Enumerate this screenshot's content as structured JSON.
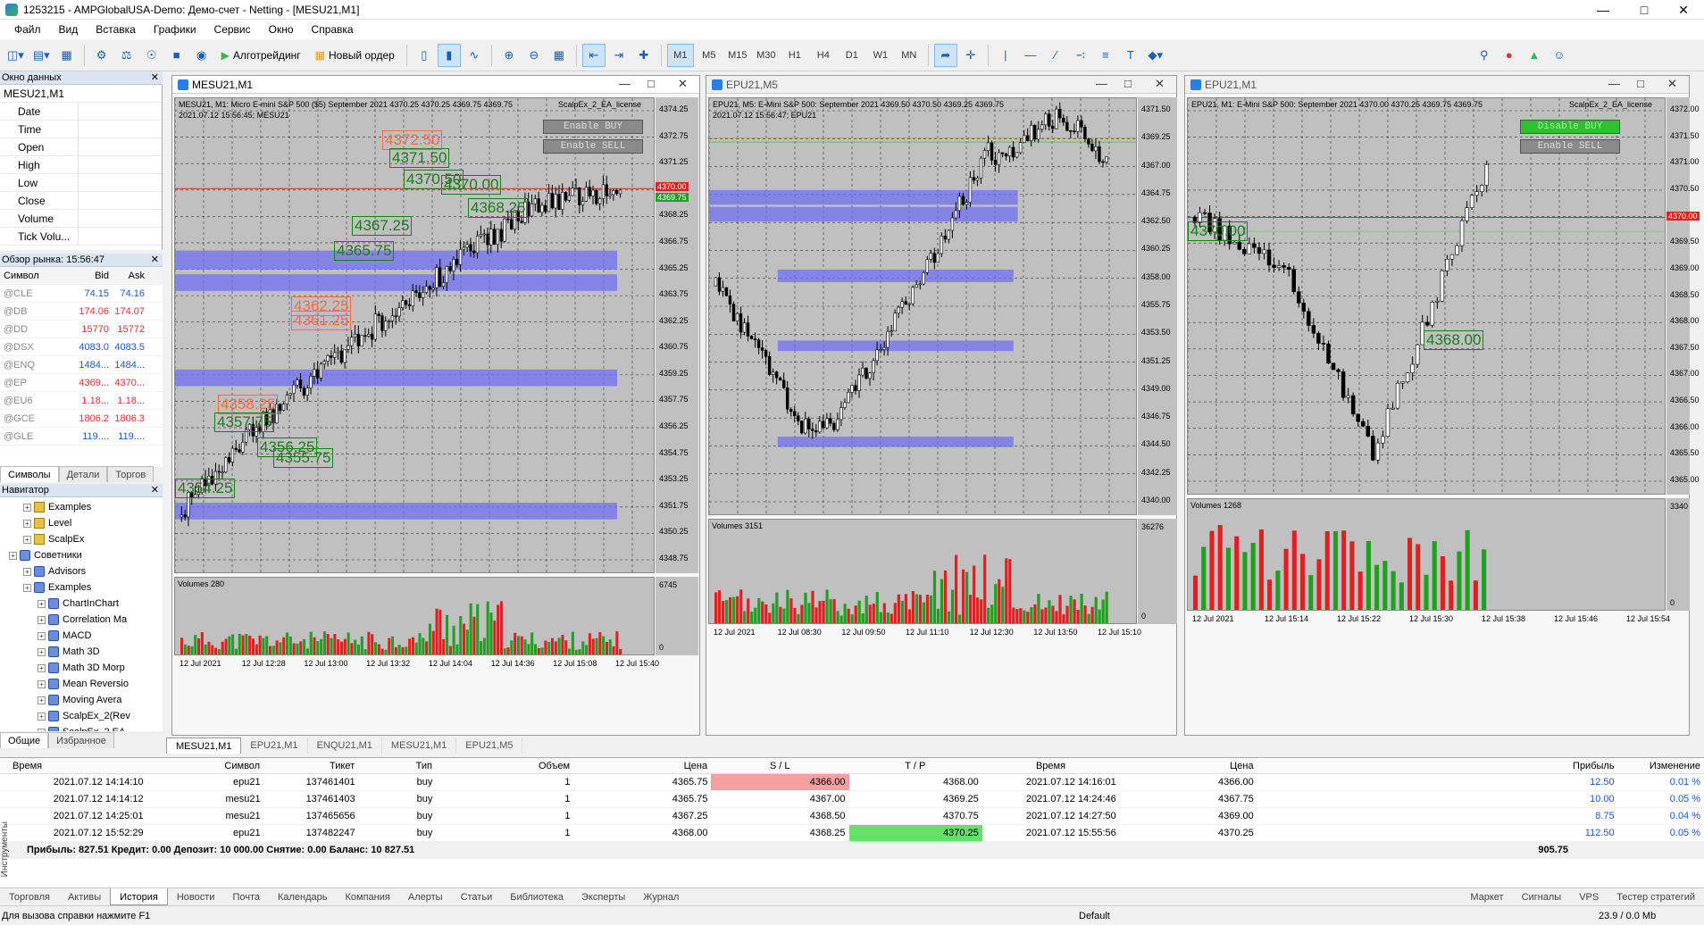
{
  "window": {
    "title": "1253215 - AMPGlobalUSA-Demo: Демо-счет - Netting - [MESU21,M1]"
  },
  "menu": [
    "Файл",
    "Вид",
    "Вставка",
    "Графики",
    "Сервис",
    "Окно",
    "Справка"
  ],
  "toolbar": {
    "algo_label": "Алготрейдинг",
    "new_order_label": "Новый ордер",
    "timeframes": [
      "M1",
      "M5",
      "M15",
      "M30",
      "H1",
      "H4",
      "D1",
      "W1",
      "MN"
    ]
  },
  "data_window": {
    "title": "Окно данных",
    "symbol": "MESU21,M1",
    "rows": [
      "Date",
      "Time",
      "Open",
      "High",
      "Low",
      "Close",
      "Volume",
      "Tick Volu..."
    ]
  },
  "market_watch": {
    "title": "Обзор рынка: 15:56:47",
    "columns": [
      "Символ",
      "Bid",
      "Ask"
    ],
    "rows": [
      {
        "s": "@CLE",
        "b": "74.15",
        "a": "74.16",
        "c": "#1f57c3"
      },
      {
        "s": "@DB",
        "b": "174.06",
        "a": "174.07",
        "c": "#e03030"
      },
      {
        "s": "@DD",
        "b": "15770",
        "a": "15772",
        "c": "#e03030"
      },
      {
        "s": "@DSX",
        "b": "4083.0",
        "a": "4083.5",
        "c": "#1f57c3"
      },
      {
        "s": "@ENQ",
        "b": "1484...",
        "a": "1484...",
        "c": "#1f57c3"
      },
      {
        "s": "@EP",
        "b": "4369...",
        "a": "4370...",
        "c": "#e03030"
      },
      {
        "s": "@EU6",
        "b": "1.18...",
        "a": "1.18...",
        "c": "#e03030"
      },
      {
        "s": "@GCE",
        "b": "1806.2",
        "a": "1806.3",
        "c": "#e03030"
      },
      {
        "s": "@GLE",
        "b": "119....",
        "a": "119....",
        "c": "#1f57c3"
      }
    ],
    "tabs": [
      "Символы",
      "Детали",
      "Торгов"
    ]
  },
  "navigator": {
    "title": "Навигатор",
    "items": [
      {
        "t": "Examples",
        "lvl": 2,
        "ic": "ind"
      },
      {
        "t": "Level",
        "lvl": 2,
        "ic": "ind"
      },
      {
        "t": "ScalpEx",
        "lvl": 2,
        "ic": "ind"
      },
      {
        "t": "Советники",
        "lvl": 1,
        "ic": "adv"
      },
      {
        "t": "Advisors",
        "lvl": 2,
        "ic": "adv"
      },
      {
        "t": "Examples",
        "lvl": 2,
        "ic": "adv"
      },
      {
        "t": "ChartInChart",
        "lvl": 3,
        "ic": "adv"
      },
      {
        "t": "Correlation Ma",
        "lvl": 3,
        "ic": "adv"
      },
      {
        "t": "MACD",
        "lvl": 3,
        "ic": "adv"
      },
      {
        "t": "Math 3D",
        "lvl": 3,
        "ic": "adv"
      },
      {
        "t": "Math 3D Morp",
        "lvl": 3,
        "ic": "adv"
      },
      {
        "t": "Mean Reversio",
        "lvl": 3,
        "ic": "adv"
      },
      {
        "t": "Moving Avera",
        "lvl": 3,
        "ic": "adv"
      },
      {
        "t": "ScalpEx_2(Rev",
        "lvl": 3,
        "ic": "adv"
      },
      {
        "t": "ScalpEx_2 EA",
        "lvl": 3,
        "ic": "adv"
      }
    ],
    "tabs": [
      "Общие",
      "Избранное"
    ]
  },
  "charts": [
    {
      "title": "MESU21,M1",
      "info": "MESU21, M1: Micro E-mini S&P 500 ($5) September 2021  4370.25 4370.25 4369.75 4369.75",
      "info2": "2021.07.12 15:56:45; MESU21",
      "buy_btn": "Enable BUY",
      "sell_btn": "Enable SELL",
      "ea": "ScalpEx_2_EA_license",
      "vol_label": "Volumes 280",
      "vol_max": "6745",
      "vol_zero": "0",
      "bid_label": "4370.00",
      "ask_label": "4369.75",
      "ticks": [
        "4374.25",
        "4372.75",
        "4371.25",
        "4369.75",
        "4368.25",
        "4366.75",
        "4365.25",
        "4363.75",
        "4362.25",
        "4360.75",
        "4359.25",
        "4357.75",
        "4356.25",
        "4354.75",
        "4353.25",
        "4351.75",
        "4350.25",
        "4348.75"
      ],
      "times": [
        "12 Jul 2021",
        "12 Jul 12:28",
        "12 Jul 13:00",
        "12 Jul 13:32",
        "12 Jul 14:04",
        "12 Jul 14:36",
        "12 Jul 15:08",
        "12 Jul 15:40"
      ],
      "labels": [
        {
          "t": "4372.50",
          "c": "red"
        },
        {
          "t": "4371.50",
          "c": "green"
        },
        {
          "t": "4370.50",
          "c": "green"
        },
        {
          "t": "4370.00",
          "c": "green"
        },
        {
          "t": "4368.25",
          "c": "green"
        },
        {
          "t": "4367.25",
          "c": "green"
        },
        {
          "t": "4365.75",
          "c": "green"
        },
        {
          "t": "4362.25",
          "c": "red"
        },
        {
          "t": "4361.25",
          "c": "red"
        },
        {
          "t": "4358.25",
          "c": "red"
        },
        {
          "t": "4357.75",
          "c": "green"
        },
        {
          "t": "4356.25",
          "c": "green"
        },
        {
          "t": "4355.75",
          "c": "green"
        },
        {
          "t": "4354.25",
          "c": "green"
        }
      ]
    },
    {
      "title": "EPU21,M5",
      "info": "EPU21, M5: E-Mini S&P 500: September 2021  4369.50 4370.50 4369.25 4369.75",
      "info2": "2021.07.12 15:56:47; EPU21",
      "vol_label": "Volumes 3151",
      "vol_max": "36276",
      "vol_zero": "0",
      "ticks": [
        "4371.50",
        "4369.25",
        "4367.00",
        "4364.75",
        "4362.50",
        "4360.25",
        "4358.00",
        "4355.75",
        "4353.50",
        "4351.25",
        "4349.00",
        "4346.75",
        "4344.50",
        "4342.25",
        "4340.00"
      ],
      "times": [
        "12 Jul 2021",
        "12 Jul 08:30",
        "12 Jul 09:50",
        "12 Jul 11:10",
        "12 Jul 12:30",
        "12 Jul 13:50",
        "12 Jul 15:10"
      ]
    },
    {
      "title": "EPU21,M1",
      "info": "EPU21, M1: E-Mini S&P 500: September 2021  4370.00 4370.25 4369.75 4369.75",
      "info2": "",
      "buy_btn": "Disable BUY",
      "sell_btn": "Enable SELL",
      "ea": "ScalpEx_2_EA_license",
      "vol_label": "Volumes 1268",
      "vol_max": "3340",
      "vol_zero": "0",
      "bid_label": "4370.00",
      "ticks": [
        "4372.00",
        "4371.50",
        "4371.00",
        "4370.50",
        "4370.00",
        "4369.50",
        "4369.00",
        "4368.50",
        "4368.00",
        "4367.50",
        "4367.00",
        "4366.50",
        "4366.00",
        "4365.50",
        "4365.00"
      ],
      "times": [
        "12 Jul 2021",
        "12 Jul 15:14",
        "12 Jul 15:22",
        "12 Jul 15:30",
        "12 Jul 15:38",
        "12 Jul 15:46",
        "12 Jul 15:54"
      ],
      "labels": [
        {
          "t": "4370.00",
          "c": "green"
        },
        {
          "t": "4368.00",
          "c": "green"
        }
      ]
    }
  ],
  "chart_tabs": [
    "MESU21,M1",
    "EPU21,M1",
    "ENQU21,M1",
    "MESU21,M1",
    "EPU21,M5"
  ],
  "history": {
    "columns": [
      "Время",
      "Символ",
      "Тикет",
      "Тип",
      "Объем",
      "Цена",
      "S / L",
      "T / P",
      "Время",
      "Цена",
      "Прибыль",
      "Изменение"
    ],
    "rows": [
      [
        "2021.07.12 14:14:10",
        "epu21",
        "137461401",
        "buy",
        "1",
        "4365.75",
        "4366.00",
        "4368.00",
        "2021.07.12 14:16:01",
        "4366.00",
        "12.50",
        "0.01 %"
      ],
      [
        "2021.07.12 14:14:12",
        "mesu21",
        "137461403",
        "buy",
        "1",
        "4365.75",
        "4367.00",
        "4369.25",
        "2021.07.12 14:24:46",
        "4367.75",
        "10.00",
        "0.05 %"
      ],
      [
        "2021.07.12 14:25:01",
        "mesu21",
        "137465656",
        "buy",
        "1",
        "4367.25",
        "4368.50",
        "4370.75",
        "2021.07.12 14:27:50",
        "4369.00",
        "8.75",
        "0.04 %"
      ],
      [
        "2021.07.12 15:52:29",
        "epu21",
        "137482247",
        "buy",
        "1",
        "4368.00",
        "4368.25",
        "4370.25",
        "2021.07.12 15:55:56",
        "4370.25",
        "112.50",
        "0.05 %"
      ]
    ],
    "balance": "Прибыль: 827.51  Кредит: 0.00  Депозит: 10 000.00  Снятие: 0.00  Баланс: 10 827.51",
    "total": "905.75",
    "side_label": "Инструменты"
  },
  "bottom_tabs": [
    "Торговля",
    "Активы",
    "История",
    "Новости",
    "Почта",
    "Календарь",
    "Компания",
    "Алерты",
    "Статьи",
    "Библиотека",
    "Эксперты",
    "Журнал"
  ],
  "bottom_right": [
    "Маркет",
    "Сигналы",
    "VPS",
    "Тестер стратегий"
  ],
  "status": {
    "help": "Для вызова справки нажмите F1",
    "profile": "Default",
    "net": "23.9 / 0.0 Mb"
  }
}
